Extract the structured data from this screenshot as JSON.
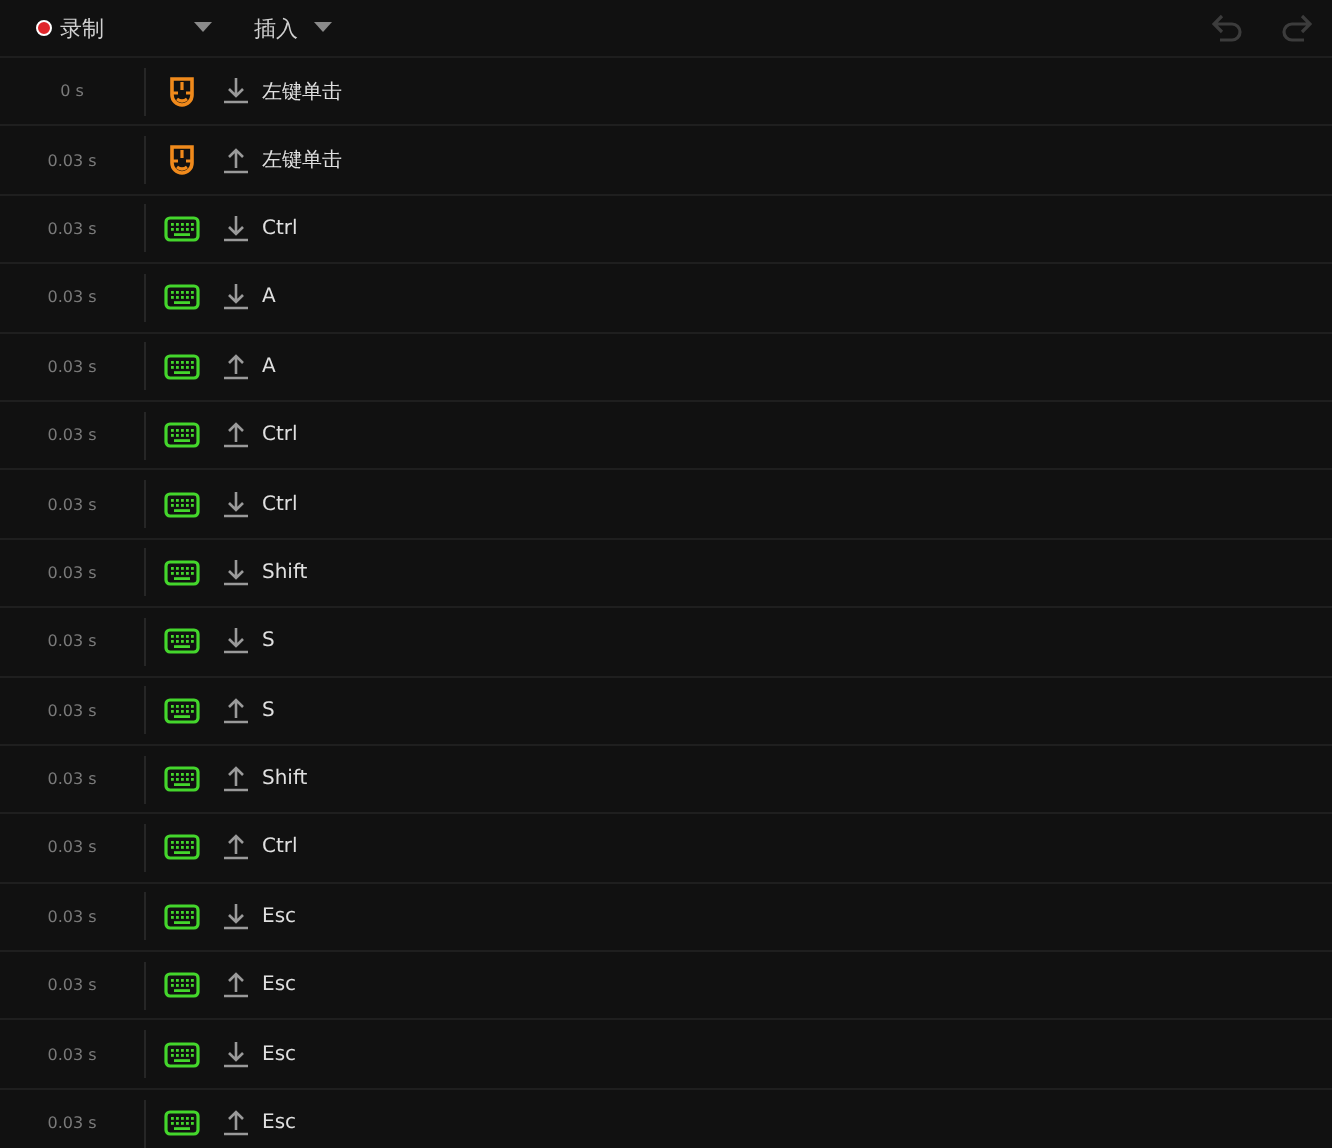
{
  "toolbar": {
    "record_label": "录制",
    "insert_label": "插入"
  },
  "events": [
    {
      "time": "0 s",
      "kind": "mouse",
      "key_down": true,
      "label": "左键单击"
    },
    {
      "time": "0.03 s",
      "kind": "mouse",
      "key_down": false,
      "label": "左键单击"
    },
    {
      "time": "0.03 s",
      "kind": "keyboard",
      "key_down": true,
      "label": "Ctrl"
    },
    {
      "time": "0.03 s",
      "kind": "keyboard",
      "key_down": true,
      "label": "A"
    },
    {
      "time": "0.03 s",
      "kind": "keyboard",
      "key_down": false,
      "label": "A"
    },
    {
      "time": "0.03 s",
      "kind": "keyboard",
      "key_down": false,
      "label": "Ctrl"
    },
    {
      "time": "0.03 s",
      "kind": "keyboard",
      "key_down": true,
      "label": "Ctrl"
    },
    {
      "time": "0.03 s",
      "kind": "keyboard",
      "key_down": true,
      "label": "Shift"
    },
    {
      "time": "0.03 s",
      "kind": "keyboard",
      "key_down": true,
      "label": "S"
    },
    {
      "time": "0.03 s",
      "kind": "keyboard",
      "key_down": false,
      "label": "S"
    },
    {
      "time": "0.03 s",
      "kind": "keyboard",
      "key_down": false,
      "label": "Shift"
    },
    {
      "time": "0.03 s",
      "kind": "keyboard",
      "key_down": false,
      "label": "Ctrl"
    },
    {
      "time": "0.03 s",
      "kind": "keyboard",
      "key_down": true,
      "label": "Esc"
    },
    {
      "time": "0.03 s",
      "kind": "keyboard",
      "key_down": false,
      "label": "Esc"
    },
    {
      "time": "0.03 s",
      "kind": "keyboard",
      "key_down": true,
      "label": "Esc"
    },
    {
      "time": "0.03 s",
      "kind": "keyboard",
      "key_down": false,
      "label": "Esc"
    }
  ]
}
